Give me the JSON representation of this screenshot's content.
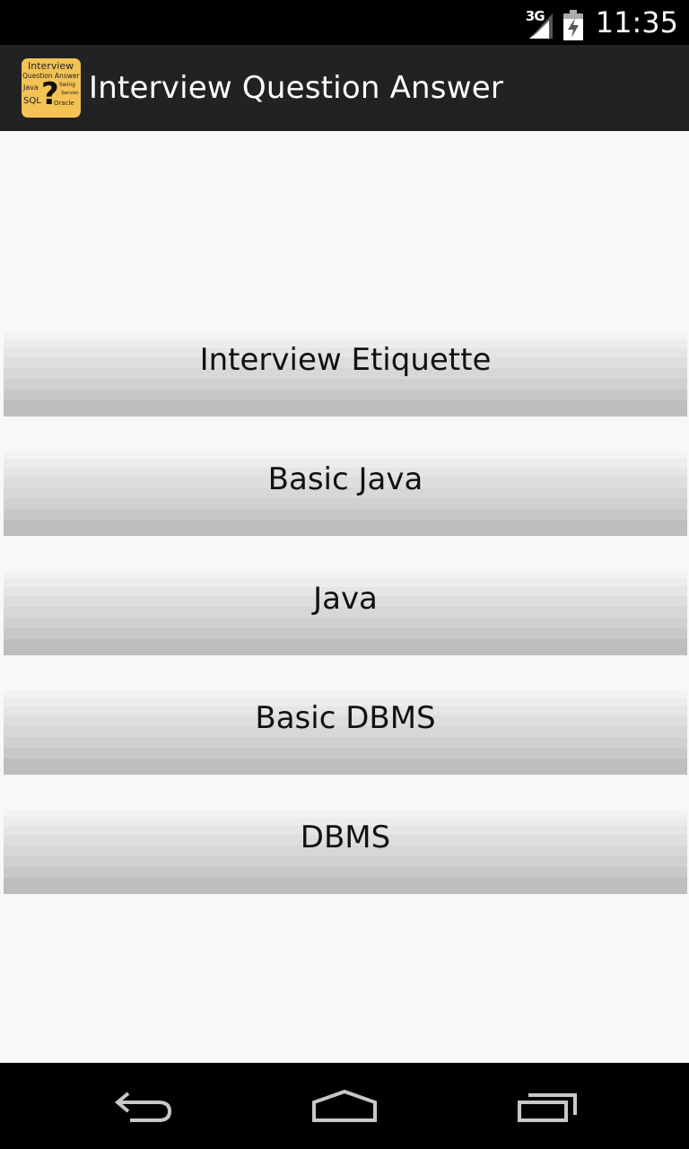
{
  "status_bar": {
    "network": "3G",
    "time": "11:35"
  },
  "action_bar": {
    "title": "Interview Question Answer",
    "icon": {
      "line1": "Interview",
      "line2": "Question Answer",
      "left_words": [
        "Java",
        "SQL"
      ],
      "right_words": [
        "Swing",
        "Servlet",
        "Oracle"
      ],
      "mark": "?"
    }
  },
  "menu": {
    "items": [
      {
        "label": "Interview Etiquette"
      },
      {
        "label": "Basic Java"
      },
      {
        "label": "Java"
      },
      {
        "label": "Basic DBMS"
      },
      {
        "label": "DBMS"
      }
    ]
  },
  "nav_bar": {
    "icons": [
      "back-icon",
      "home-icon",
      "recent-apps-icon"
    ]
  },
  "colors": {
    "status_bar": "#000000",
    "action_bar": "#222222",
    "content_bg": "#f8f8f8",
    "app_icon_bg": "#f4c255",
    "nav_bar": "#000000"
  }
}
